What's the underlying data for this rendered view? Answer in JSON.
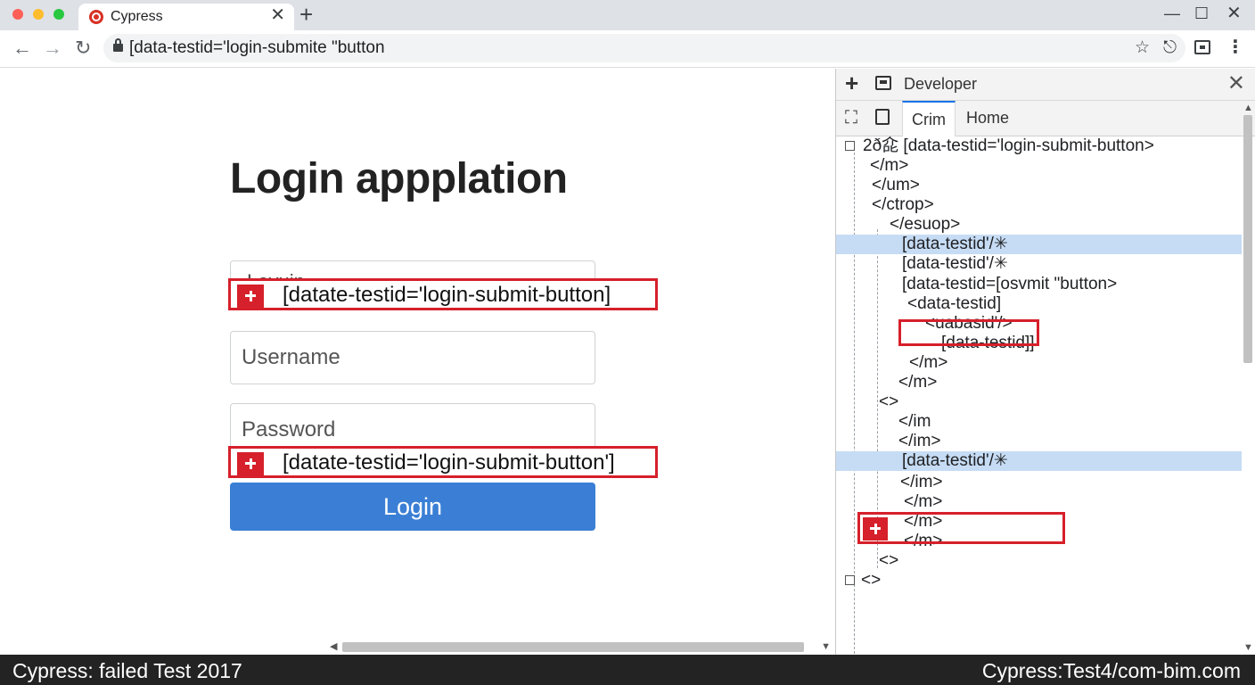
{
  "browser": {
    "tab_title": "Cypress",
    "tab_close": "✕",
    "new_tab": "+",
    "url": "[data-testid='login-submite \"button",
    "window_controls": {
      "minimize": "—",
      "maximize": "☐",
      "close": "✕"
    },
    "nav": {
      "back": "←",
      "forward": "→",
      "reload": "↻"
    },
    "icons": [
      "lock-icon",
      "star-icon",
      "share-icon",
      "extension-icon",
      "menu-icon"
    ]
  },
  "app": {
    "title": "Login appplation",
    "login_field_ghost": "Lovuin",
    "username_placeholder": "Username",
    "password_placeholder": "Password",
    "login_button": "Login",
    "highlight_1": "[datate-testid='login-submit-button]",
    "highlight_2": "[datate-testid='login-submit-button']"
  },
  "devtools": {
    "title": "Developer",
    "close": "✕",
    "tabs": [
      "Crim",
      "Home"
    ],
    "selected_tab": "Crim",
    "dom_lines": [
      "2ð㖋 [data-testid='login-submit-button>",
      "</m>",
      "</um>",
      "</ctrop>",
      "</esuop>",
      "[data-testid'/✳",
      "[data-testid'/✳",
      "[data-testid=[osvmit \"button>",
      "<data-testid]",
      "<uabasid'/>",
      "[data-testid]]",
      "</m>",
      "</m>",
      "<>",
      "</im",
      "</im>",
      "[data-testid'/✳",
      "</im>",
      "</m>",
      "</m>",
      "</m>",
      "<>",
      "<>"
    ]
  },
  "status": {
    "left": "Cypress: failed Test 2017",
    "right": "Cypress:Test4/com-bim.com"
  },
  "colors": {
    "accent_blue": "#3a7fd5",
    "highlight_red": "#d6202b",
    "selection_blue": "#c6dcf4",
    "status_bar": "#232323"
  }
}
